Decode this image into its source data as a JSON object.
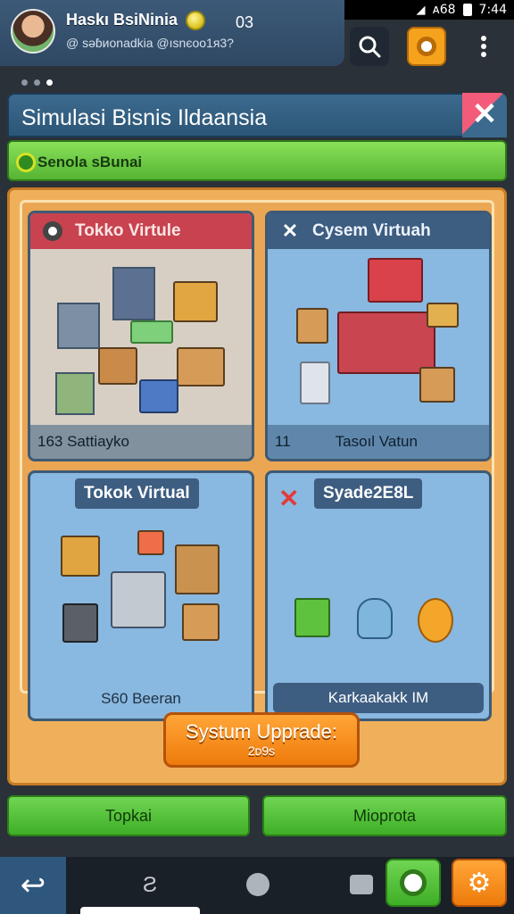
{
  "status_bar": {
    "signal": "◢",
    "network": "ᴀ68",
    "time": "7:44"
  },
  "header": {
    "player_name": "Haskı BsiNinia",
    "player_level": "03",
    "player_handle": "@ ѕəɓиonadkia @ısnєoo1ᴙ3?",
    "search_icon": "search-icon",
    "notice_icon": "notification-icon",
    "more_icon": "more-vertical-icon"
  },
  "title_bar": {
    "title": "Simulasi Bisnis Ildaansia",
    "close_label": "✕"
  },
  "progress": {
    "label": "Senola ѕBunai",
    "fraction": 1.0
  },
  "cards": [
    {
      "title": "Tokko Virtule",
      "footer_left": "163 Sattiayko",
      "footer_right": ""
    },
    {
      "title": "Cysem Virtuah",
      "footer_left": "11",
      "footer_right": "Tasoıl Vatun"
    },
    {
      "title": "Tokok Virtual",
      "footer_left": "S60 Beeran",
      "footer_right": ""
    },
    {
      "title": "Syade2E8L",
      "footer_left": "Karkaakakk IM",
      "footer_right": ""
    }
  ],
  "upgrade_button": {
    "line1": "Systum Upprade:",
    "line2": "2ᴅ9s"
  },
  "buttons": {
    "left": "Topkai",
    "right": "Mioprota"
  },
  "navbar": {
    "back": "↩",
    "mid_label": "Ƨ"
  },
  "colors": {
    "header_bg": "#3c5a78",
    "accent_orange": "#f5a21c",
    "accent_green": "#4cb026",
    "panel_orange": "#f0b05b"
  }
}
